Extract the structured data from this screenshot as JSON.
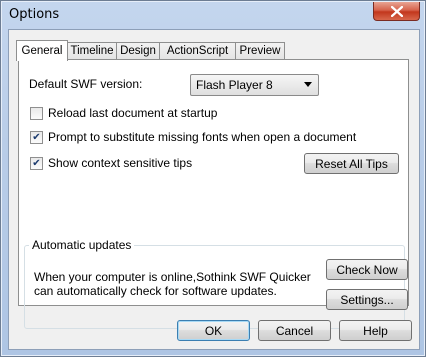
{
  "window": {
    "title": "Options",
    "close_icon": "close-icon"
  },
  "tabs": [
    {
      "label": "General",
      "active": true
    },
    {
      "label": "Timeline",
      "active": false
    },
    {
      "label": "Design",
      "active": false
    },
    {
      "label": "ActionScript",
      "active": false
    },
    {
      "label": "Preview",
      "active": false
    }
  ],
  "general": {
    "swf_version_label": "Default SWF version:",
    "swf_version_value": "Flash Player 8",
    "reload_label": "Reload last document at startup",
    "reload_checked": false,
    "prompt_fonts_label": "Prompt to substitute missing fonts when open a document",
    "prompt_fonts_checked": true,
    "show_tips_label": "Show context sensitive tips",
    "show_tips_checked": true,
    "reset_tips_label": "Reset All Tips"
  },
  "updates": {
    "group_title": "Automatic updates",
    "description_line1": "When your computer is online,Sothink SWF Quicker",
    "description_line2": "can automatically check for software updates.",
    "check_now_label": "Check Now",
    "settings_label": "Settings..."
  },
  "footer": {
    "ok_label": "OK",
    "cancel_label": "Cancel",
    "help_label": "Help"
  },
  "colors": {
    "checkmark": "#1b3a6e",
    "title_bar": "#b9cde8",
    "close_button": "#c2371d"
  }
}
